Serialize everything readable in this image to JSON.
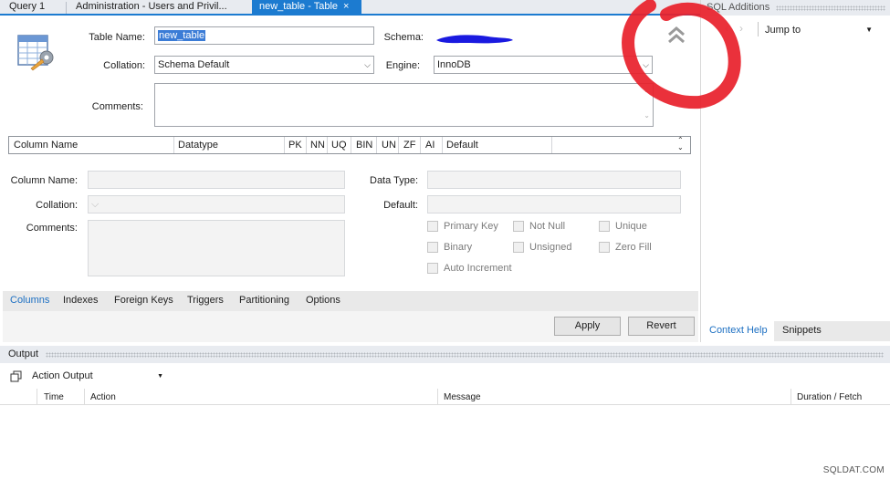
{
  "tabs": [
    {
      "label": "Query 1"
    },
    {
      "label": "Administration - Users and Privil..."
    },
    {
      "label": "new_table - Table",
      "close": "×"
    }
  ],
  "table_form": {
    "table_name_label": "Table Name:",
    "table_name_value": "new_table",
    "schema_label": "Schema:",
    "collation_label": "Collation:",
    "collation_value": "Schema Default",
    "engine_label": "Engine:",
    "engine_value": "InnoDB",
    "comments_label": "Comments:"
  },
  "columns_grid": {
    "headers": [
      "Column Name",
      "Datatype",
      "PK",
      "NN",
      "UQ",
      "BIN",
      "UN",
      "ZF",
      "AI",
      "Default"
    ]
  },
  "column_detail": {
    "column_name_label": "Column Name:",
    "collation_label": "Collation:",
    "comments_label": "Comments:",
    "data_type_label": "Data Type:",
    "default_label": "Default:",
    "checkboxes": [
      "Primary Key",
      "Not Null",
      "Unique",
      "Binary",
      "Unsigned",
      "Zero Fill",
      "Auto Increment"
    ]
  },
  "bottom_tabs": [
    "Columns",
    "Indexes",
    "Foreign Keys",
    "Triggers",
    "Partitioning",
    "Options"
  ],
  "buttons": {
    "apply": "Apply",
    "revert": "Revert"
  },
  "right_panel": {
    "title": "SQL Additions",
    "jump_to": "Jump to",
    "tabs": [
      "Context Help",
      "Snippets"
    ]
  },
  "output": {
    "title": "Output",
    "selector": "Action Output",
    "columns": [
      "Time",
      "Action",
      "Message",
      "Duration / Fetch"
    ]
  },
  "watermark": "SQLDAT.COM",
  "colors": {
    "accent": "#1c7bd0",
    "annotation_red": "#e8202a",
    "redaction_blue": "#1a1ae0"
  },
  "icons": [
    "table-icon",
    "collapse-up-icon",
    "dropdown-arrow-icon",
    "scroll-arrows-icon",
    "copy-icon"
  ]
}
